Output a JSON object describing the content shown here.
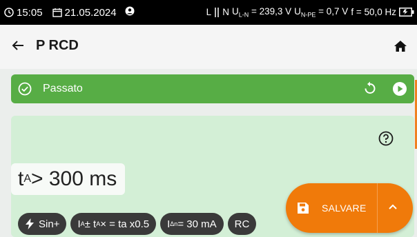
{
  "status_bar": {
    "time": "15:05",
    "date": "21.05.2024",
    "l_label": "L",
    "n_label": "N",
    "u_ln_prefix": "U",
    "u_ln_sub": "L-N",
    "u_ln_value": " = 239,3 V",
    "u_npe_prefix": "U",
    "u_npe_sub": "N-PE",
    "u_npe_value": " = 0,7 V",
    "freq": "f = 50,0 Hz"
  },
  "header": {
    "title": "P RCD"
  },
  "result_banner": {
    "label": "Passato",
    "color": "#57ad45"
  },
  "measurement": {
    "main_prefix": "t",
    "main_sub": "A",
    "main_value": " > 300 ms"
  },
  "chips": [
    {
      "label": "Sin+"
    },
    {
      "p1": "I",
      "s1": "A",
      "p2": "± t",
      "s2": "A",
      "p3": "× = ta x0.5"
    },
    {
      "p1": "I",
      "s1": "Δn",
      "p2": " = 30 mA"
    },
    {
      "label": "RC"
    }
  ],
  "fab": {
    "save_label": "SALVARE",
    "color": "#f07a0a"
  },
  "icons": {
    "clock": "clock-icon",
    "calendar": "calendar-icon",
    "user": "user-icon",
    "battery": "battery-icon",
    "back": "arrow-left-icon",
    "home": "home-icon",
    "check": "check-circle-icon",
    "redo": "redo-icon",
    "play": "play-icon",
    "help": "help-circle-icon",
    "bolt": "lightning-icon",
    "save": "save-icon",
    "chevron": "chevron-up-icon"
  },
  "colors": {
    "accent": "#f07a0a",
    "pass": "#57ad45",
    "panel": "#d3efd6"
  }
}
